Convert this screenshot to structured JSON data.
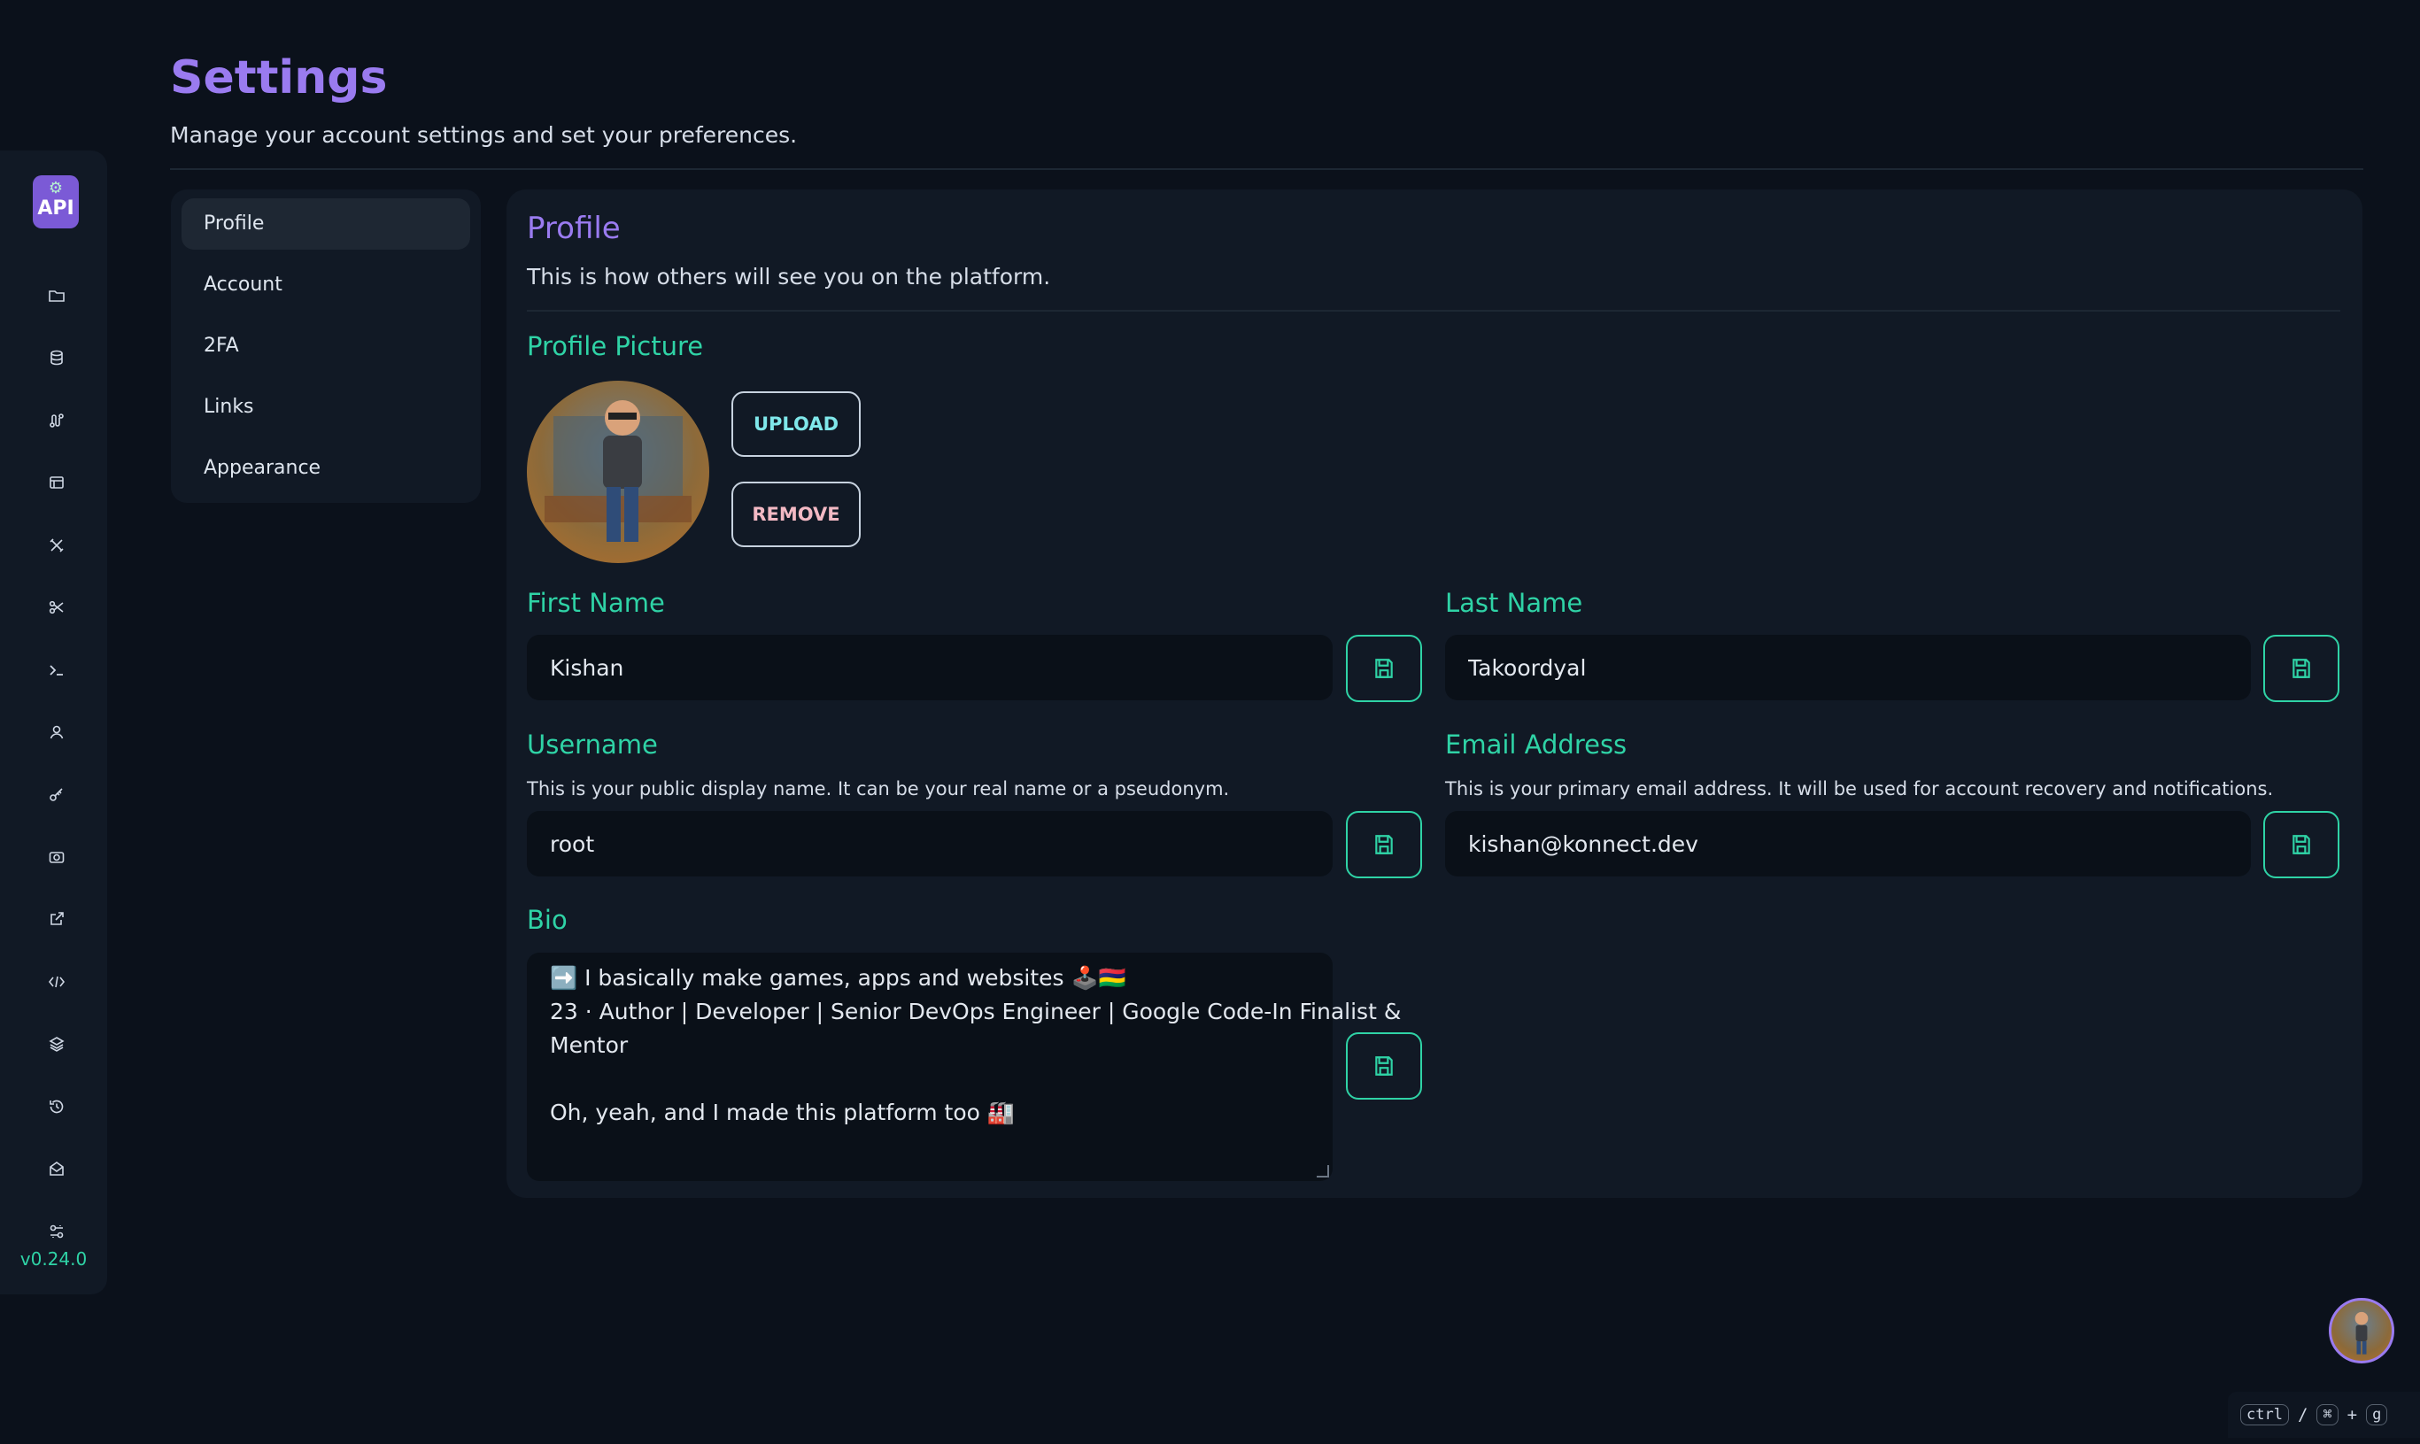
{
  "header": {
    "title": "Settings",
    "subtitle": "Manage your account settings and set your preferences."
  },
  "rail": {
    "logo_text": "API",
    "icons": [
      "folder-icon",
      "database-icon",
      "route-icon",
      "browser-icon",
      "tools-icon",
      "scissors-icon",
      "terminal-icon",
      "user-icon",
      "key-icon",
      "camera-icon",
      "external-link-icon",
      "code-icon",
      "layers-icon",
      "history-icon",
      "mail-icon",
      "settings-sliders-icon"
    ],
    "version": "v0.24.0"
  },
  "settings_nav": {
    "items": [
      {
        "label": "Profile",
        "active": true
      },
      {
        "label": "Account"
      },
      {
        "label": "2FA"
      },
      {
        "label": "Links"
      },
      {
        "label": "Appearance"
      }
    ]
  },
  "profile": {
    "title": "Profile",
    "subtitle": "This is how others will see you on the platform.",
    "picture_label": "Profile Picture",
    "upload_label": "UPLOAD",
    "remove_label": "REMOVE",
    "first_name": {
      "label": "First Name",
      "value": "Kishan"
    },
    "last_name": {
      "label": "Last Name",
      "value": "Takoordyal"
    },
    "username": {
      "label": "Username",
      "help": "This is your public display name. It can be your real name or a pseudonym.",
      "value": "root"
    },
    "email": {
      "label": "Email Address",
      "help": "This is your primary email address. It will be used for account recovery and notifications.",
      "value": "kishan@konnect.dev"
    },
    "bio": {
      "label": "Bio",
      "line1": "➡️ I basically make games, apps and websites 🕹️🇲🇺",
      "line2": "23 · Author | Developer | Senior DevOps Engineer | Google Code-In Finalist &",
      "line3": "Mentor",
      "line4": "",
      "line5": "Oh, yeah, and I made this platform too 🏭"
    }
  },
  "shortcut": {
    "key1": "ctrl",
    "sep": "/",
    "key2": "⌘",
    "plus": "+",
    "key3": "g"
  },
  "colors": {
    "accent_purple": "#9a7bf0",
    "accent_green": "#2fd3a6",
    "background": "#0b111b",
    "panel": "#111925"
  }
}
